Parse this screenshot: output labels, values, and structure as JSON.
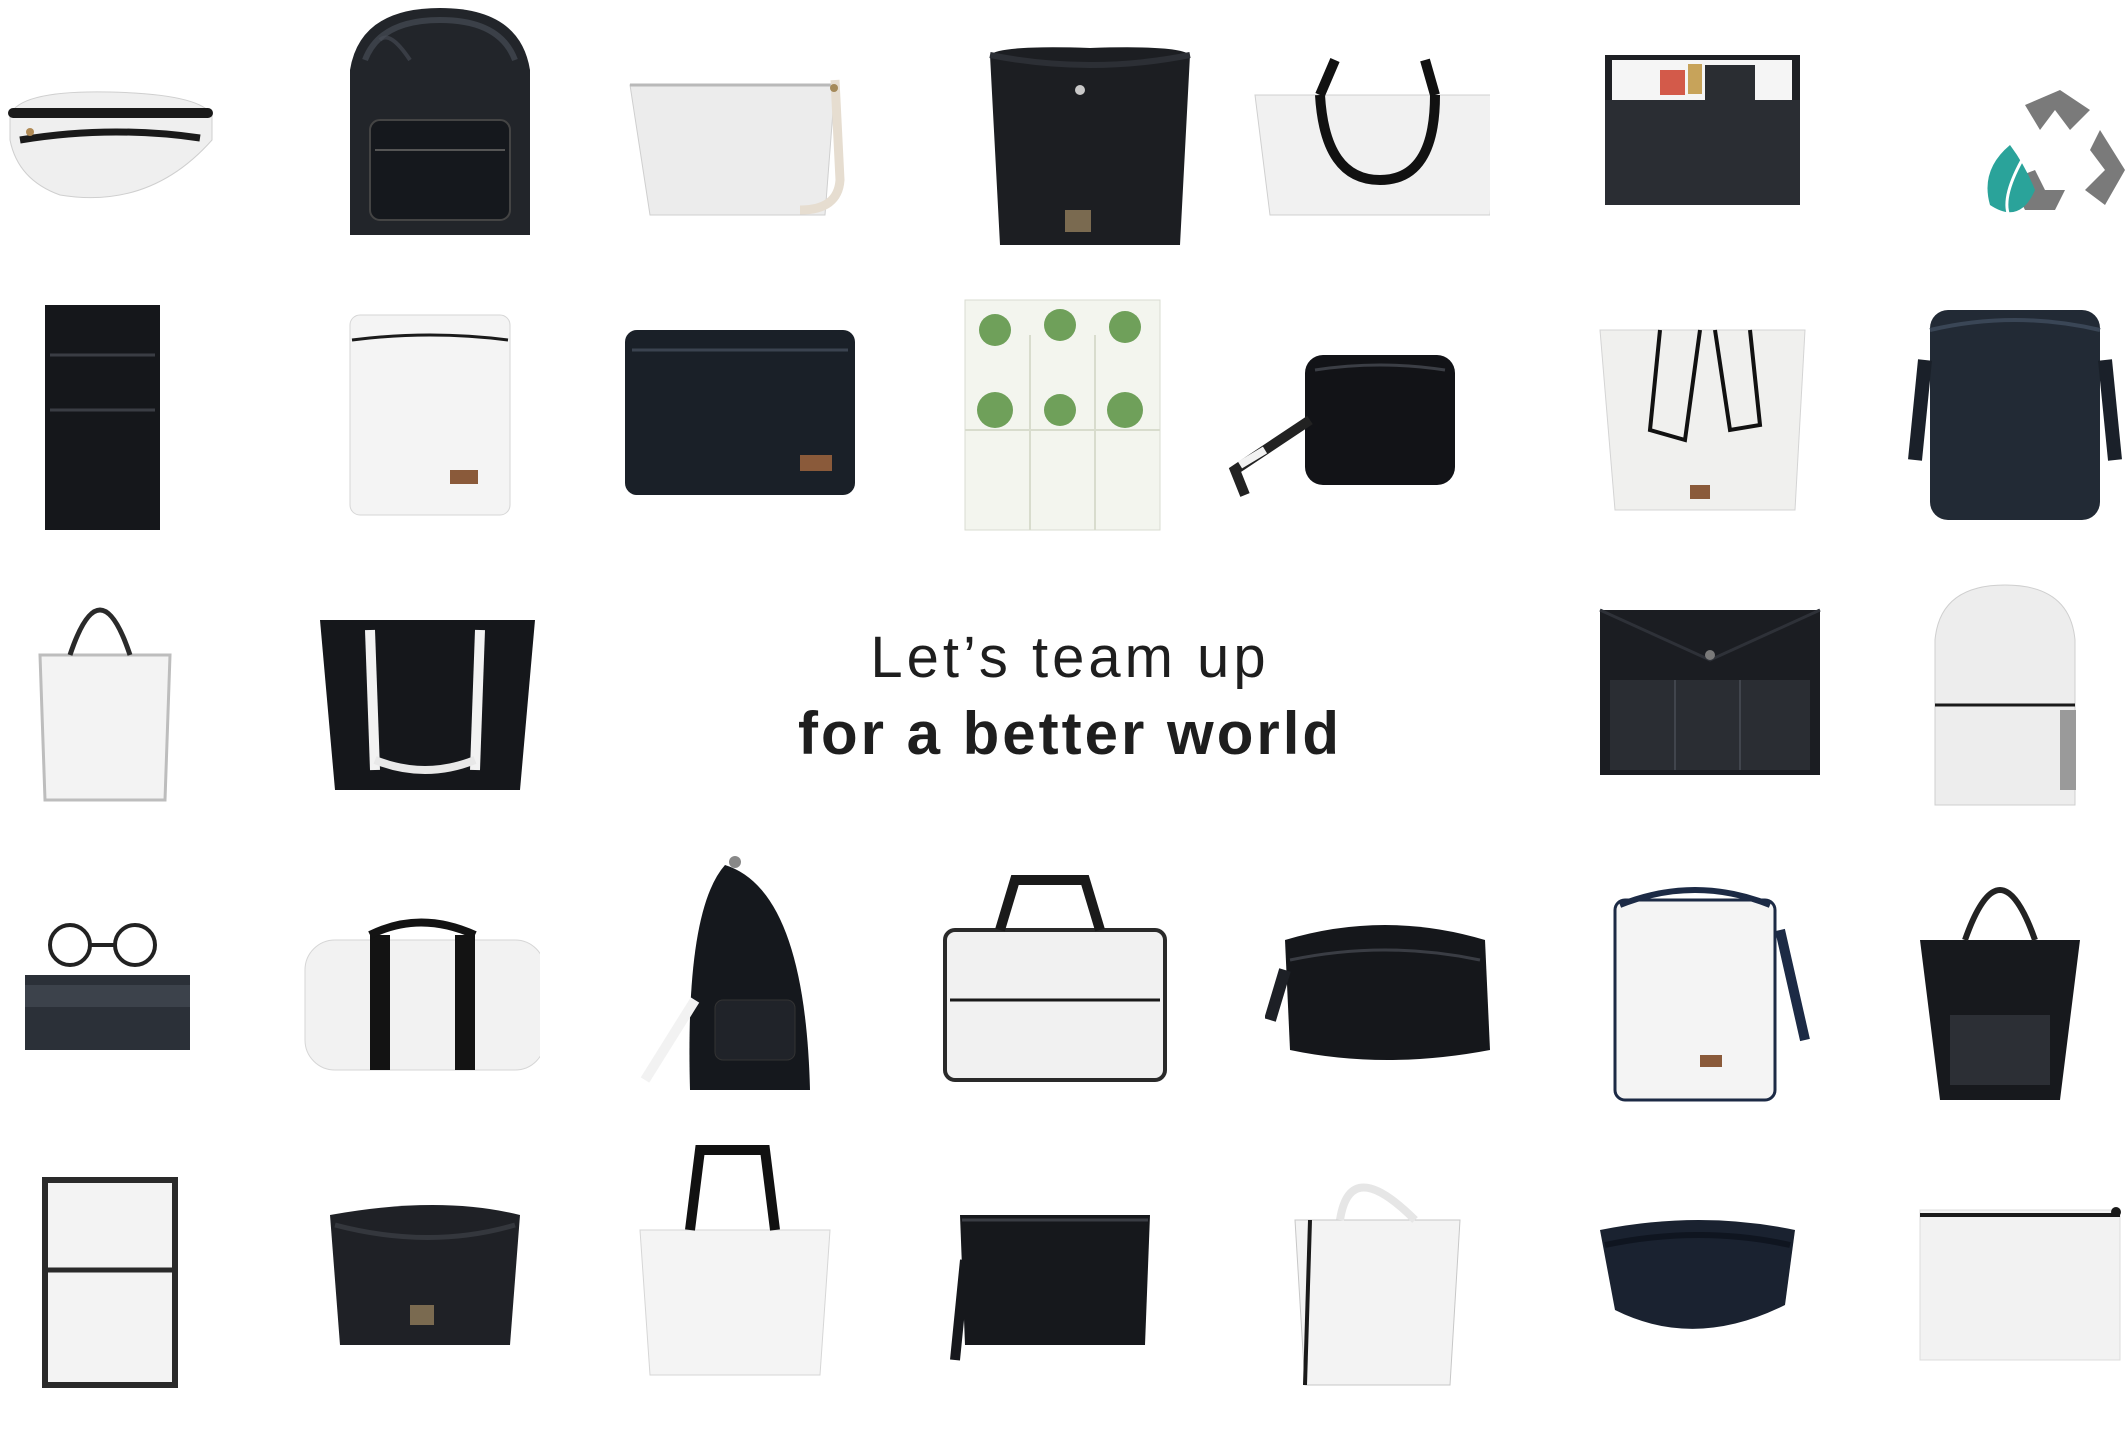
{
  "headline": {
    "line1": "Let’s team up",
    "line2": "for a better world"
  },
  "colors": {
    "background": "#ffffff",
    "text": "#1e1e1e",
    "recycle_teal": "#2aa39a",
    "recycle_gray": "#7a7a7a",
    "product_black": "#15181d",
    "product_white": "#f1f1f1"
  },
  "products": [
    {
      "row": 1,
      "col": 1,
      "item": "white-fanny-pack"
    },
    {
      "row": 1,
      "col": 2,
      "item": "black-glossy-backpack"
    },
    {
      "row": 1,
      "col": 3,
      "item": "white-pouch-with-strap"
    },
    {
      "row": 1,
      "col": 4,
      "item": "black-felt-basket"
    },
    {
      "row": 1,
      "col": 5,
      "item": "white-tote-black-handles"
    },
    {
      "row": 1,
      "col": 6,
      "item": "black-desk-organizer"
    },
    {
      "row": 1,
      "col": 7,
      "item": "recycle-icon"
    },
    {
      "row": 2,
      "col": 1,
      "item": "black-wall-pocket-organizer"
    },
    {
      "row": 2,
      "col": 2,
      "item": "white-laptop-sleeve"
    },
    {
      "row": 2,
      "col": 3,
      "item": "black-laptop-sleeve"
    },
    {
      "row": 2,
      "col": 4,
      "item": "vertical-garden-planter"
    },
    {
      "row": 2,
      "col": 5,
      "item": "black-crossbody-bag"
    },
    {
      "row": 2,
      "col": 6,
      "item": "white-shopper-tote"
    },
    {
      "row": 2,
      "col": 7,
      "item": "black-cooler-bag"
    },
    {
      "row": 3,
      "col": 1,
      "item": "white-tall-tote"
    },
    {
      "row": 3,
      "col": 2,
      "item": "black-glossy-tote"
    },
    {
      "row": 3,
      "col": 6,
      "item": "black-document-folder"
    },
    {
      "row": 3,
      "col": 7,
      "item": "white-backpack"
    },
    {
      "row": 4,
      "col": 1,
      "item": "glasses-case"
    },
    {
      "row": 4,
      "col": 2,
      "item": "white-duffel-bag"
    },
    {
      "row": 4,
      "col": 3,
      "item": "black-sling-backpack"
    },
    {
      "row": 4,
      "col": 4,
      "item": "white-laptop-bag"
    },
    {
      "row": 4,
      "col": 5,
      "item": "black-toiletry-bag"
    },
    {
      "row": 4,
      "col": 6,
      "item": "white-cooler-bag"
    },
    {
      "row": 4,
      "col": 7,
      "item": "black-tote-with-pocket"
    },
    {
      "row": 5,
      "col": 1,
      "item": "white-lunch-bag"
    },
    {
      "row": 5,
      "col": 2,
      "item": "black-felt-storage-basket"
    },
    {
      "row": 5,
      "col": 3,
      "item": "white-shopping-tote"
    },
    {
      "row": 5,
      "col": 4,
      "item": "black-wristlet-pouch"
    },
    {
      "row": 5,
      "col": 5,
      "item": "white-shopping-bag"
    },
    {
      "row": 5,
      "col": 6,
      "item": "black-belt-bag"
    },
    {
      "row": 5,
      "col": 7,
      "item": "white-zip-pouch"
    }
  ]
}
